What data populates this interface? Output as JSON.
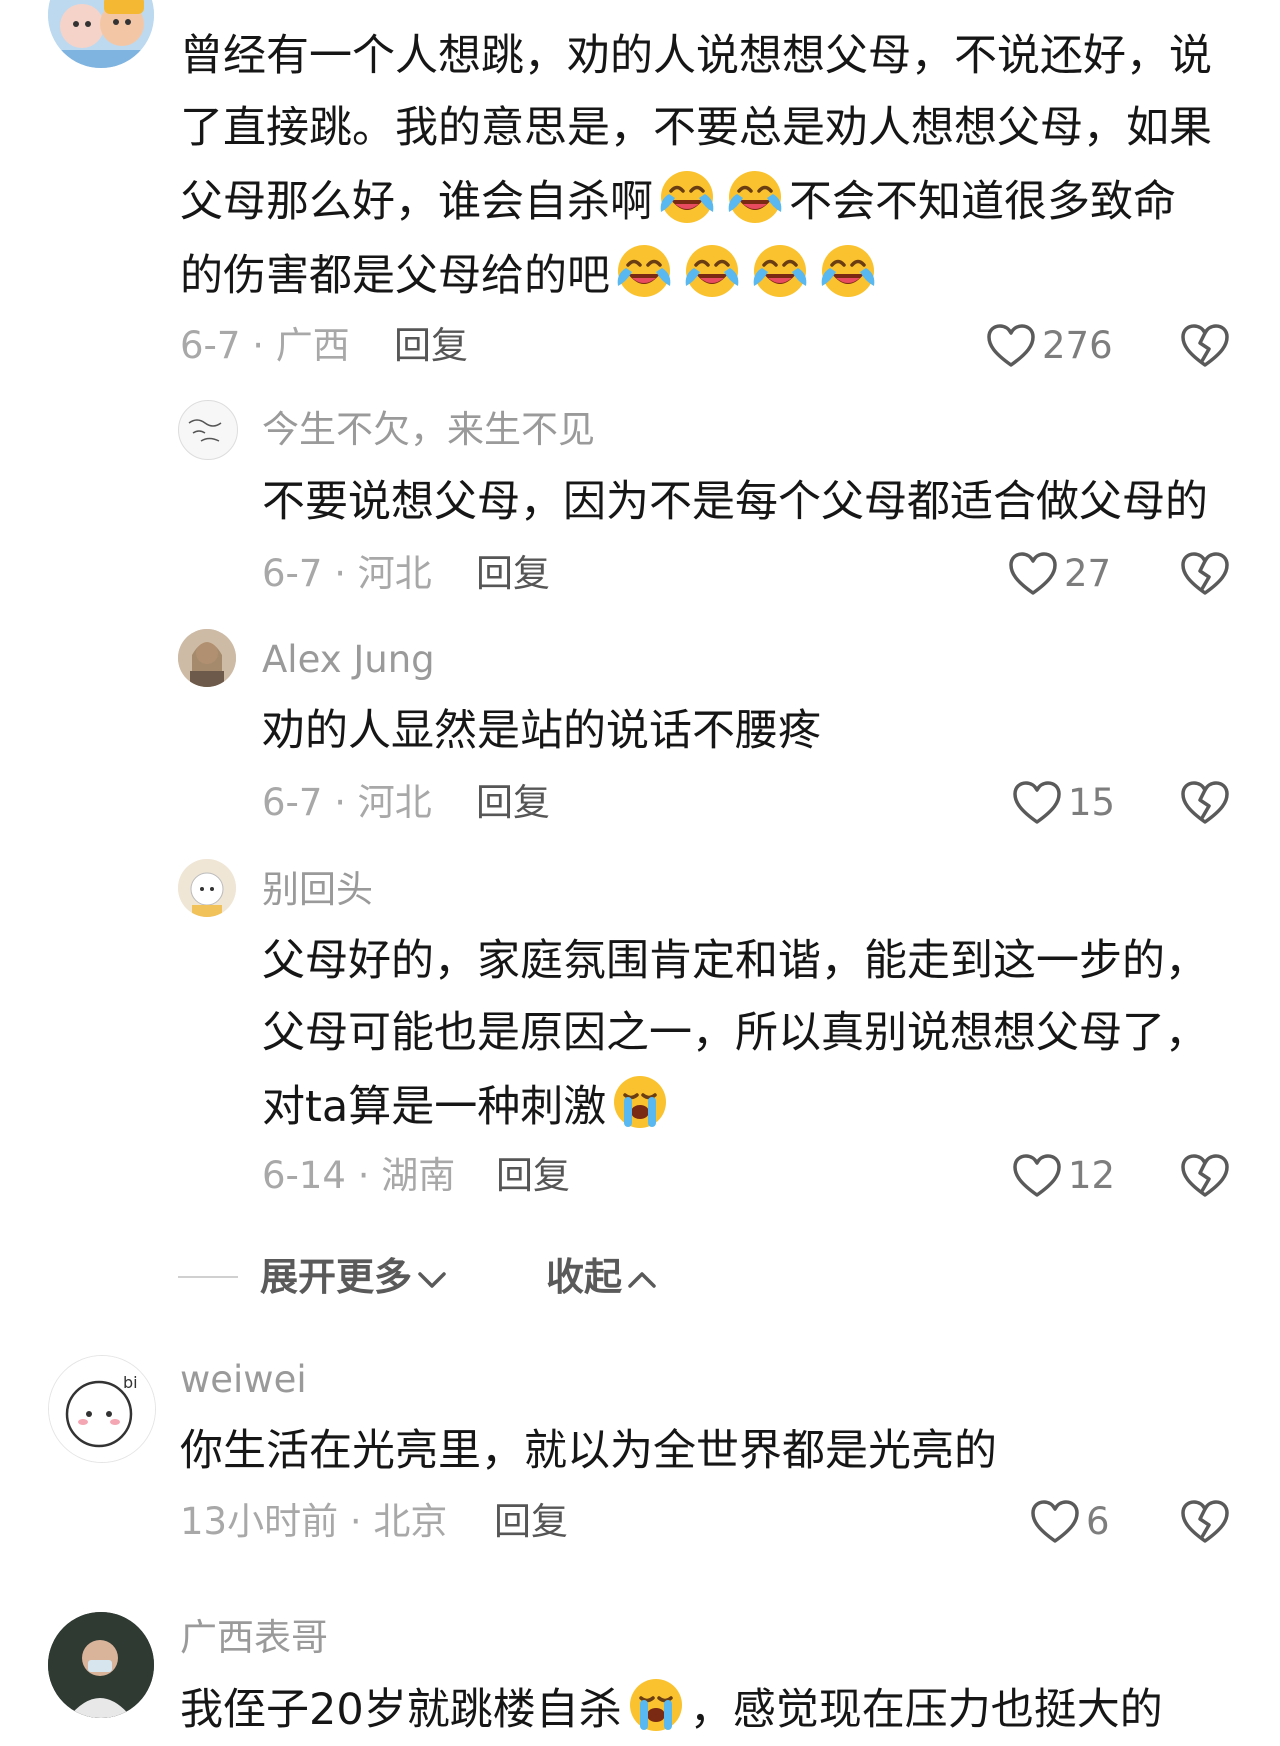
{
  "comments": [
    {
      "text_lines": [
        "曾经有一个人想跳，劝的人说想想父母，不说还好，说",
        "了直接跳。我的意思是，不要总是劝人想想父母，如果",
        "父母那么好，谁会自杀啊",
        "不会不知道很多致命",
        "的伤害都是父母给的吧"
      ],
      "date_location": "6-7 · 广西",
      "reply_label": "回复",
      "likes": "276"
    }
  ],
  "replies": [
    {
      "username": "今生不欠，来生不见",
      "text_lines": [
        "不要说想父母，因为不是每个父母都适合做父母的"
      ],
      "date_location": "6-7 · 河北",
      "reply_label": "回复",
      "likes": "27"
    },
    {
      "username": "Alex Jung",
      "text_lines": [
        "劝的人显然是站的说话不腰疼"
      ],
      "date_location": "6-7 · 河北",
      "reply_label": "回复",
      "likes": "15"
    },
    {
      "username": "别回头",
      "text_lines": [
        "父母好的，家庭氛围肯定和谐，能走到这一步的，",
        "父母可能也是原因之一，所以真别说想想父母了，",
        "对ta算是一种刺激"
      ],
      "date_location": "6-14 · 湖南",
      "reply_label": "回复",
      "likes": "12"
    }
  ],
  "thread_controls": {
    "expand_label": "展开更多",
    "collapse_label": "收起"
  },
  "more_comments": [
    {
      "username": "weiwei",
      "text_lines": [
        "你生活在光亮里，就以为全世界都是光亮的"
      ],
      "date_location": "13小时前 · 北京",
      "reply_label": "回复",
      "likes": "6"
    },
    {
      "username": "广西表哥",
      "text_lines": [
        "我侄子20岁就跳楼自杀",
        "，感觉现在压力也挺大的"
      ]
    }
  ],
  "emoji": {
    "joy": "tears-of-joy-emoji",
    "cry": "loudly-crying-emoji"
  },
  "colors": {
    "text": "#161616",
    "muted": "#9a9a9a",
    "reply": "#565656",
    "emoji_yellow": "#f9c22e"
  }
}
